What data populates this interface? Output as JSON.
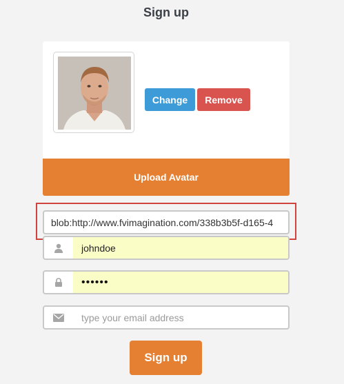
{
  "page": {
    "title": "Sign up"
  },
  "avatar": {
    "change_label": "Change",
    "remove_label": "Remove",
    "upload_label": "Upload Avatar"
  },
  "form": {
    "avatar_url": {
      "value": "blob:http://www.fvimagination.com/338b3b5f-d165-4"
    },
    "username": {
      "value": "johndoe",
      "icon": "user-icon"
    },
    "password": {
      "value": "••••••",
      "icon": "lock-icon"
    },
    "email": {
      "value": "",
      "placeholder": "type your email address",
      "icon": "envelope-icon"
    }
  },
  "submit": {
    "label": "Sign up"
  },
  "colors": {
    "accent": "#e57f31",
    "change": "#3d9bd8",
    "remove": "#d9534f",
    "autofill": "#fbfdc6",
    "highlight": "#d0433c"
  }
}
